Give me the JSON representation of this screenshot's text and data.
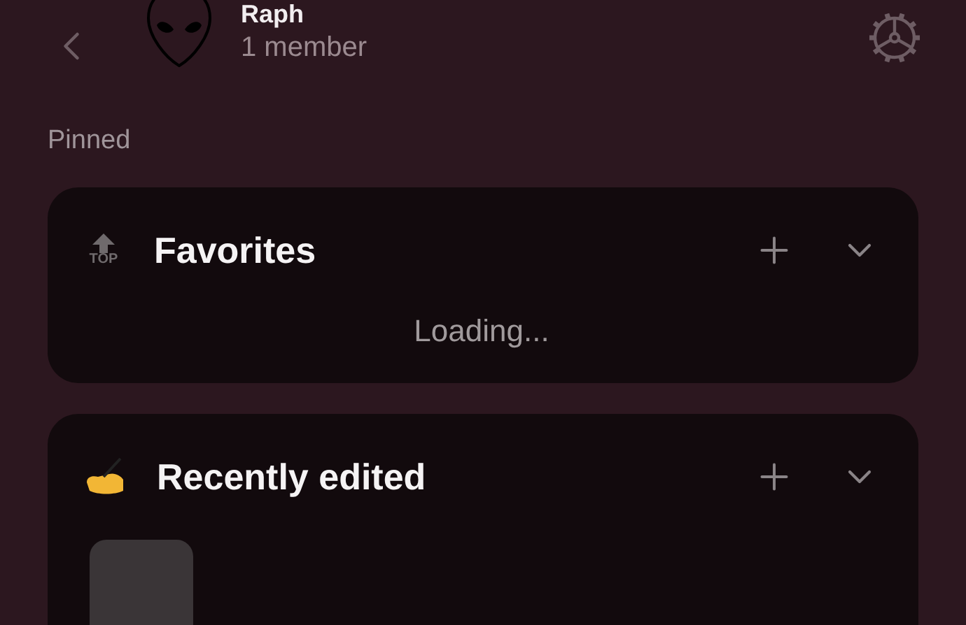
{
  "header": {
    "title": "Raph",
    "subtitle": "1 member"
  },
  "section_label": "Pinned",
  "cards": [
    {
      "kind": "top",
      "icon_label": "TOP",
      "title": "Favorites",
      "status": "Loading...",
      "expanded": false
    },
    {
      "kind": "writing",
      "title": "Recently edited",
      "expanded": false,
      "items": [
        {
          "kind": "thumbnail"
        }
      ]
    }
  ]
}
